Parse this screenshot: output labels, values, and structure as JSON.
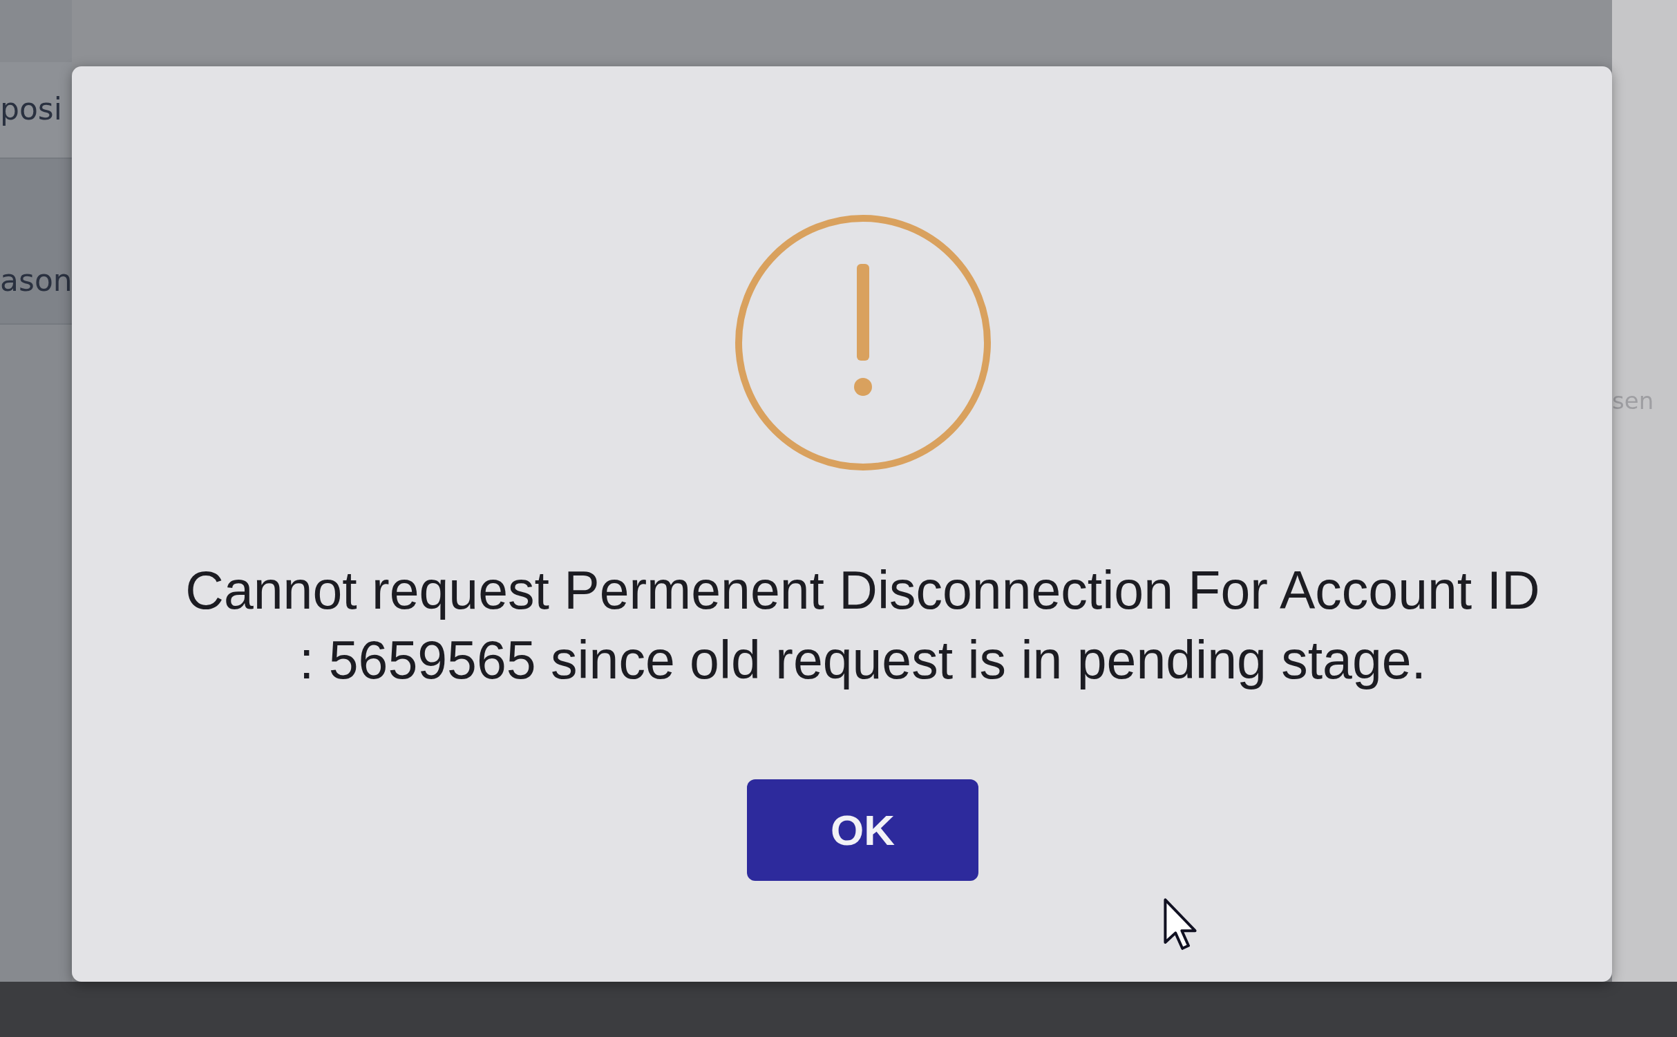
{
  "background_page": {
    "left_labels": [
      "posi",
      "ason"
    ],
    "right_label": "sen"
  },
  "dialog": {
    "message": "Cannot request Permenent Disconnection For Account ID : 5659565 since old request is in pending stage.",
    "button": "OK"
  }
}
